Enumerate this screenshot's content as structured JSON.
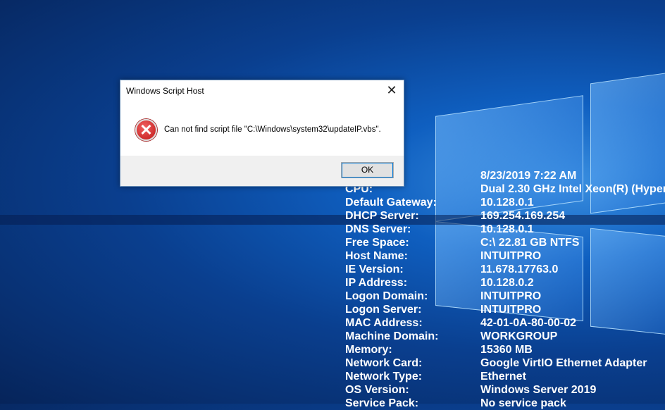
{
  "dialog": {
    "title": "Windows Script Host",
    "message": "Can not find script file \"C:\\Windows\\system32\\updateIP.vbs\".",
    "ok_label": "OK",
    "close_glyph": "✕",
    "icon": "error-icon"
  },
  "info": [
    {
      "label": "",
      "value": "8/23/2019 7:22 AM"
    },
    {
      "label": "CPU:",
      "value": "Dual 2.30 GHz Intel Xeon(R) (Hyper"
    },
    {
      "label": "Default Gateway:",
      "value": "10.128.0.1"
    },
    {
      "label": "DHCP Server:",
      "value": "169.254.169.254"
    },
    {
      "label": "DNS Server:",
      "value": "10.128.0.1"
    },
    {
      "label": "Free Space:",
      "value": "C:\\ 22.81 GB NTFS"
    },
    {
      "label": "Host Name:",
      "value": "INTUITPRO"
    },
    {
      "label": "IE Version:",
      "value": "11.678.17763.0"
    },
    {
      "label": "IP Address:",
      "value": "10.128.0.2"
    },
    {
      "label": "Logon Domain:",
      "value": "INTUITPRO"
    },
    {
      "label": "Logon Server:",
      "value": "INTUITPRO"
    },
    {
      "label": "MAC Address:",
      "value": "42-01-0A-80-00-02"
    },
    {
      "label": "Machine Domain:",
      "value": "WORKGROUP"
    },
    {
      "label": "Memory:",
      "value": "15360 MB"
    },
    {
      "label": "Network Card:",
      "value": "Google VirtIO Ethernet Adapter"
    },
    {
      "label": "Network Type:",
      "value": "Ethernet"
    },
    {
      "label": "OS Version:",
      "value": "Windows Server 2019"
    },
    {
      "label": "Service Pack:",
      "value": "No service pack"
    }
  ]
}
